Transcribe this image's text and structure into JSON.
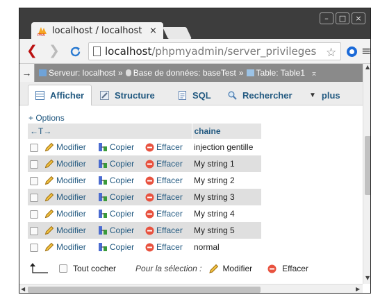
{
  "browser": {
    "tab_title": "localhost / localhost",
    "tab_close": "×",
    "window_buttons": [
      "–",
      "□",
      "×"
    ],
    "url_host": "localhost",
    "url_path": "/phpmyadmin/server_privileges"
  },
  "breadcrumb": {
    "arrow": "→",
    "server": "Serveur: localhost",
    "sep1": "»",
    "database": "Base de données: baseTest",
    "sep2": "»",
    "table": "Table: Table1",
    "collapse": "⌅"
  },
  "tabs": [
    {
      "label": "Afficher",
      "active": true
    },
    {
      "label": "Structure",
      "active": false
    },
    {
      "label": "SQL",
      "active": false
    },
    {
      "label": "Rechercher",
      "active": false
    },
    {
      "label": "plus",
      "active": false
    }
  ],
  "options_link": "+ Options",
  "table": {
    "sort_arrows": "←T→",
    "column": "chaine",
    "actions": {
      "edit": "Modifier",
      "copy": "Copier",
      "delete": "Effacer"
    },
    "rows": [
      "injection gentille",
      "My string 1",
      "My string 2",
      "My string 3",
      "My string 4",
      "My string 5",
      "normal"
    ]
  },
  "bulk": {
    "check_all": "Tout cocher",
    "with_selected": "Pour la sélection :",
    "edit": "Modifier",
    "delete": "Effacer"
  },
  "colors": {
    "link": "#235a81",
    "row_alt": "#dfdfdf",
    "breadcrumb_bg": "#8a8a8a",
    "titlebar": "#3d3d3d",
    "delete_red": "#e8523f",
    "edit_pencil": "#e0a020"
  }
}
